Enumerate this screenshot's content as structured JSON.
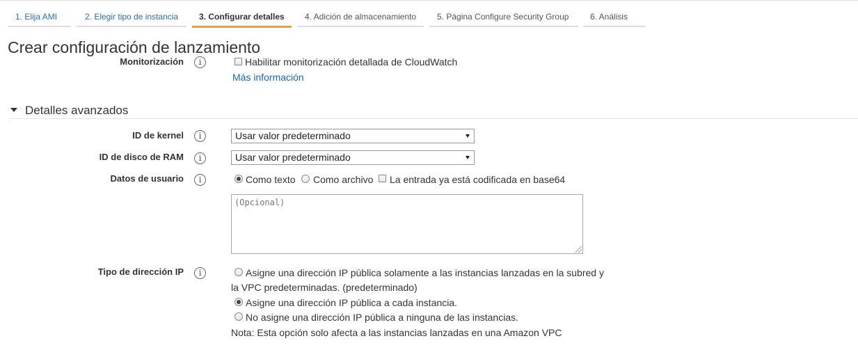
{
  "wizard": {
    "tabs": [
      {
        "label": "1. Elija AMI",
        "state": "done"
      },
      {
        "label": "2. Elegir tipo de instancia",
        "state": "done"
      },
      {
        "label": "3. Configurar detalles",
        "state": "active"
      },
      {
        "label": "4. Adición de almacenamiento",
        "state": "pending"
      },
      {
        "label": "5. Página Configure Security Group",
        "state": "pending"
      },
      {
        "label": "6. Análisis",
        "state": "pending"
      }
    ]
  },
  "page": {
    "title": "Crear configuración de lanzamiento"
  },
  "monitoring": {
    "label": "Monitorización",
    "checkbox_label": "Habilitar monitorización detallada de CloudWatch",
    "checked": false,
    "more_info": "Más información"
  },
  "advanced": {
    "title": "Detalles avanzados",
    "kernel": {
      "label": "ID de kernel",
      "value": "Usar valor predeterminado"
    },
    "ramdisk": {
      "label": "ID de disco de RAM",
      "value": "Usar valor predeterminado"
    },
    "user_data": {
      "label": "Datos de usuario",
      "as_text": "Como texto",
      "as_file": "Como archivo",
      "base64": "La entrada ya está codificada en base64",
      "selected": "as_text",
      "placeholder": "(Opcional)"
    },
    "ip": {
      "label": "Tipo de dirección IP",
      "option1_line1": "Asigne una dirección IP pública solamente a las instancias lanzadas en la subred y",
      "option1_line2": "la VPC predeterminadas. (predeterminado)",
      "option2": "Asigne una dirección IP pública a cada instancia.",
      "option3": "No asigne una dirección IP pública a ninguna de las instancias.",
      "note": "Nota: Esta opción solo afecta a las instancias lanzadas en una Amazon VPC",
      "selected": "option2"
    }
  },
  "icons": {
    "info": "info-icon",
    "caret": "caret-down-icon",
    "select_arrow": "dropdown-arrow-icon"
  },
  "colors": {
    "link": "#1a66b0",
    "active_tab_underline": "#e7a23a"
  }
}
